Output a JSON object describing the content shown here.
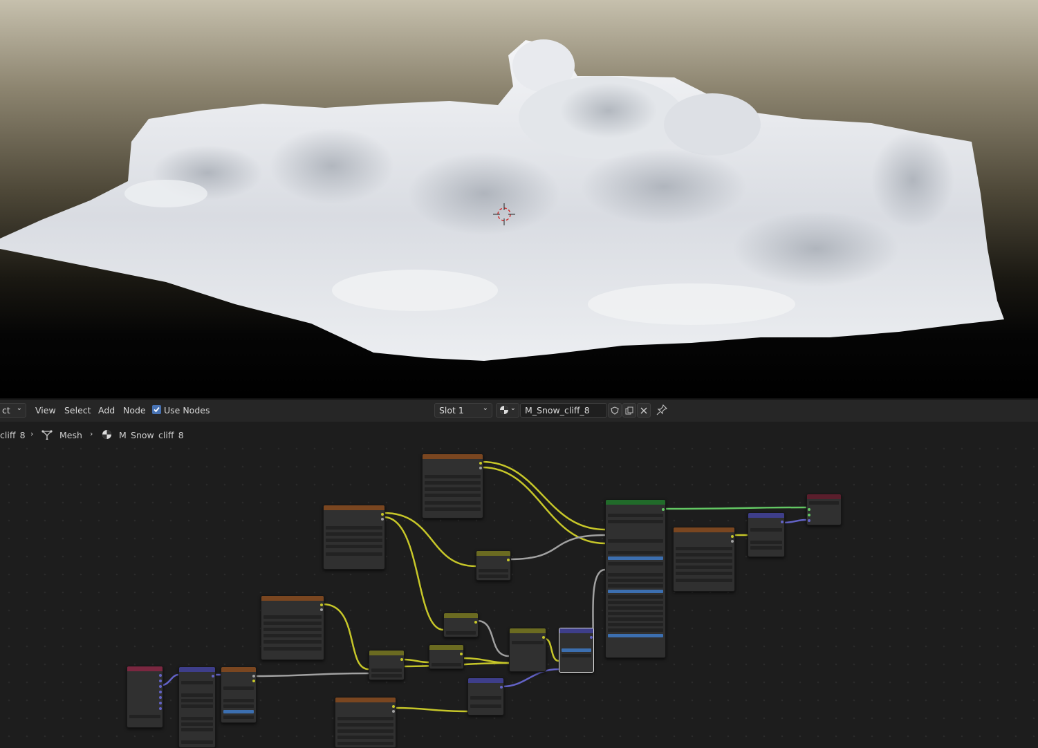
{
  "header": {
    "editor_type_partial": "ct",
    "menu": [
      "View",
      "Select",
      "Add",
      "Node"
    ],
    "use_nodes_label": "Use Nodes",
    "use_nodes_checked": true,
    "slot_label": "Slot 1",
    "material_name": "M_Snow_cliff_8"
  },
  "breadcrumb": {
    "object_partial": "cliff_8",
    "mesh": "Mesh",
    "material": "M_Snow_cliff_8"
  },
  "icons": [
    "chevron-down-icon",
    "checkbox-icon",
    "material-sphere-icon",
    "shield-icon",
    "duplicate-icon",
    "close-icon",
    "pin-icon",
    "mesh-icon",
    "chevron-right-icon"
  ],
  "colors": {
    "header_bg": "#262626",
    "editor_bg": "#1d1d1d",
    "texture_node": "#7a4620",
    "color_node": "#6b6b21",
    "shader_node": "#216b2a",
    "vector_node": "#3e3e8a",
    "input_node": "#7a2740",
    "output_node": "#5a1e2c",
    "checkbox_accent": "#4772b3"
  }
}
